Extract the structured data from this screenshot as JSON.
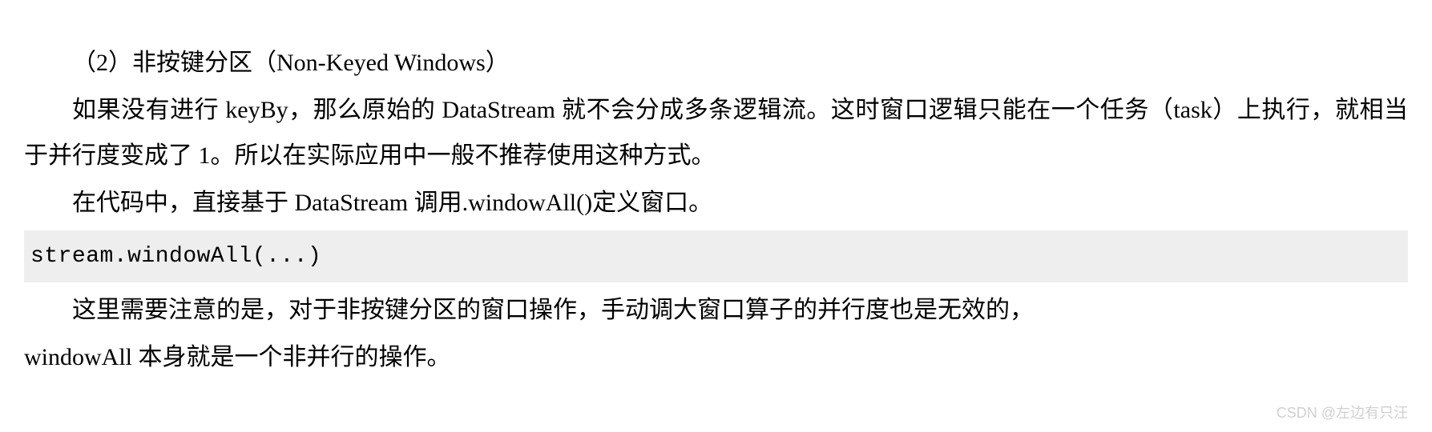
{
  "document": {
    "heading": {
      "prefix": "（2）非按键分区（",
      "latin": "Non-Keyed Windows",
      "suffix": "）"
    },
    "para1": {
      "seg1": "如果没有进行 ",
      "seg2_latin": "keyBy",
      "seg3": "，那么原始的 ",
      "seg4_latin": "DataStream ",
      "seg5": "就不会分成多条逻辑流。这时窗口逻辑只能在一个任务（",
      "seg6_latin": "task",
      "seg7": "）上执行，就相当于并行度变成了 1。所以在实际应用中一般不推荐使用这种方式。"
    },
    "para2": {
      "seg1": "在代码中，直接基于 ",
      "seg2_latin": "DataStream ",
      "seg3": "调用",
      "seg4_latin": ".windowAll()",
      "seg5": "定义窗口。"
    },
    "code": "stream.windowAll(...)",
    "para3": {
      "seg1": "这里需要注意的是，对于非按键分区的窗口操作，手动调大窗口算子的并行度也是无效的，",
      "seg2_latin": "windowAll ",
      "seg3": "本身就是一个非并行的操作。"
    },
    "watermark": "CSDN @左边有只汪"
  }
}
